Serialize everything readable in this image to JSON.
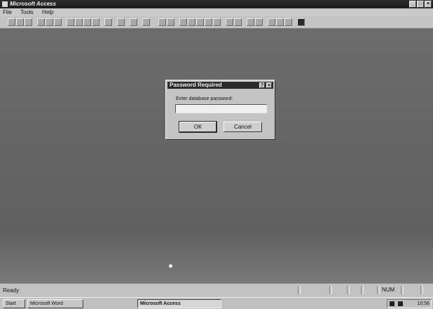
{
  "window": {
    "title": "Microsoft Access",
    "controls": [
      "_",
      "□",
      "×"
    ]
  },
  "menubar": {
    "items": [
      "File",
      "Tools",
      "Help"
    ]
  },
  "toolbar": {
    "icons": [
      "new-icon",
      "open-icon",
      "save-icon",
      "print-icon",
      "print-preview-icon",
      "spelling-icon",
      "cut-icon",
      "copy-icon",
      "paste-icon",
      "format-painter-icon",
      "undo-icon",
      "office-links-icon",
      "analyze-icon",
      "code-icon",
      "properties-icon",
      "relationships-icon",
      "new-object-icon",
      "help-icon"
    ]
  },
  "dialog": {
    "title": "Password Required",
    "help_glyph": "?",
    "close_glyph": "×",
    "prompt": "Enter database password:",
    "password_value": "",
    "ok_label": "OK",
    "cancel_label": "Cancel"
  },
  "statusbar": {
    "text": "Ready",
    "num": "NUM"
  },
  "taskbar": {
    "start_label": "Start",
    "tasks": [
      {
        "label": "Microsoft Word",
        "active": false
      },
      {
        "label": "Microsoft Access",
        "active": true
      }
    ],
    "clock": "10:56"
  }
}
